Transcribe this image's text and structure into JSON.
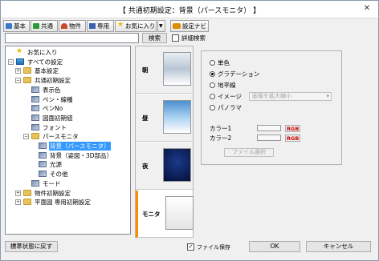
{
  "window": {
    "title": "【 共通初期設定：背景（パースモニタ） 】",
    "close_glyph": "✕"
  },
  "toolbar": {
    "items": [
      {
        "label": "基本",
        "icon": "kihon-icon",
        "color": "#3a78c8"
      },
      {
        "label": "共通",
        "icon": "kyoutsu-icon",
        "color": "#2a9a3a"
      },
      {
        "label": "物件",
        "icon": "bukken-icon",
        "color": "#c84a2a"
      },
      {
        "label": "専用",
        "icon": "senyou-icon",
        "color": "#3a60b0"
      },
      {
        "label": "お気に入り",
        "icon": "favorites-icon",
        "color": "#f0b400"
      },
      {
        "label": "▼",
        "icon": "dropdown-arrow-icon",
        "color": "#333333"
      },
      {
        "label": "設定ナビ",
        "icon": "settings-navi-icon",
        "color": "#e08a00"
      }
    ]
  },
  "search": {
    "value": "",
    "button_label": "検索",
    "detail_search_label": "詳細検索",
    "detail_search_checked": false
  },
  "tree": {
    "items": [
      {
        "label": "お気に入り",
        "level": 0,
        "icon": "star",
        "exp": ""
      },
      {
        "label": "すべての設定",
        "level": 0,
        "icon": "root",
        "exp": "−"
      },
      {
        "label": "基本設定",
        "level": 1,
        "icon": "folder",
        "exp": "+"
      },
      {
        "label": "共通初期設定",
        "level": 1,
        "icon": "folder",
        "exp": "−"
      },
      {
        "label": "表示色",
        "level": 2,
        "icon": "doc",
        "exp": ""
      },
      {
        "label": "ペン・線種",
        "level": 2,
        "icon": "doc",
        "exp": ""
      },
      {
        "label": "ペンNo",
        "level": 2,
        "icon": "doc",
        "exp": ""
      },
      {
        "label": "図面初期値",
        "level": 2,
        "icon": "doc",
        "exp": ""
      },
      {
        "label": "フォント",
        "level": 2,
        "icon": "doc",
        "exp": ""
      },
      {
        "label": "パースモニタ",
        "level": 2,
        "icon": "folder",
        "exp": "−"
      },
      {
        "label": "背景（パースモニタ）",
        "level": 3,
        "icon": "doc",
        "exp": "",
        "selected": true
      },
      {
        "label": "背景（姿図・3D部品）",
        "level": 3,
        "icon": "doc",
        "exp": ""
      },
      {
        "label": "光源",
        "level": 3,
        "icon": "doc",
        "exp": ""
      },
      {
        "label": "その他",
        "level": 3,
        "icon": "doc",
        "exp": ""
      },
      {
        "label": "モード",
        "level": 2,
        "icon": "doc",
        "exp": ""
      },
      {
        "label": "物件初期設定",
        "level": 1,
        "icon": "folder",
        "exp": "+"
      },
      {
        "label": "平面図 専用初期設定",
        "level": 1,
        "icon": "folder",
        "exp": "+"
      }
    ]
  },
  "tabs": [
    {
      "label": "朝",
      "gradient": "linear-gradient(#e8eef4,#b8c6d4,#ffffff)",
      "active": false
    },
    {
      "label": "昼",
      "gradient": "linear-gradient(#4a90d0,#a8d0f0,#ffffff)",
      "active": false
    },
    {
      "label": "夜",
      "gradient": "radial-gradient(circle at 50% 40%,#1c3a8a,#04103a)",
      "active": false
    },
    {
      "label": "モニタ",
      "gradient": "linear-gradient(#ffffff,#e4e4e4)",
      "active": true
    }
  ],
  "panel": {
    "options": [
      {
        "label": "単色",
        "checked": false
      },
      {
        "label": "グラデーション",
        "checked": true
      },
      {
        "label": "地平線",
        "checked": false
      },
      {
        "label": "イメージ",
        "checked": false
      },
      {
        "label": "パノラマ",
        "checked": false
      }
    ],
    "image_mode_value": "画像を拡大縮小",
    "color1_label": "カラー1",
    "color2_label": "カラー2",
    "rgb_label": "RGB",
    "file_select_label": "ファイル選択"
  },
  "footer": {
    "reset_label": "標準状態に戻す",
    "save_file_label": "ファイル保存",
    "save_file_checked": true,
    "ok_label": "OK",
    "cancel_label": "キャンセル"
  },
  "accent_color": "#ff8c00",
  "selection_color": "#3399ff"
}
